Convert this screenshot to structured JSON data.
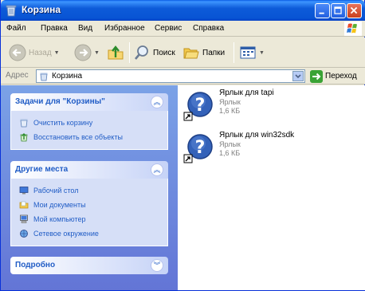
{
  "window": {
    "title": "Корзина",
    "icon": "recycle-bin-icon"
  },
  "menu": {
    "items": [
      "Файл",
      "Правка",
      "Вид",
      "Избранное",
      "Сервис",
      "Справка"
    ]
  },
  "toolbar": {
    "back_label": "Назад",
    "search_label": "Поиск",
    "folders_label": "Папки"
  },
  "address": {
    "label": "Адрес",
    "value": "Корзина",
    "go_label": "Переход"
  },
  "tasks_panel": {
    "title": "Задачи для \"Корзины\"",
    "items": [
      "Очистить корзину",
      "Восстановить все объекты"
    ]
  },
  "places_panel": {
    "title": "Другие места",
    "items": [
      "Рабочий стол",
      "Мои документы",
      "Мой компьютер",
      "Сетевое окружение"
    ]
  },
  "details_panel": {
    "title": "Подробно"
  },
  "files": [
    {
      "name": "Ярлык для tapi",
      "type": "Ярлык",
      "size": "1,6 КБ"
    },
    {
      "name": "Ярлык для win32sdk",
      "type": "Ярлык",
      "size": "1,6 КБ"
    }
  ],
  "colors": {
    "titlebar": "#0854d4",
    "taskpane": "#7ba2e7",
    "link": "#215dc6"
  }
}
